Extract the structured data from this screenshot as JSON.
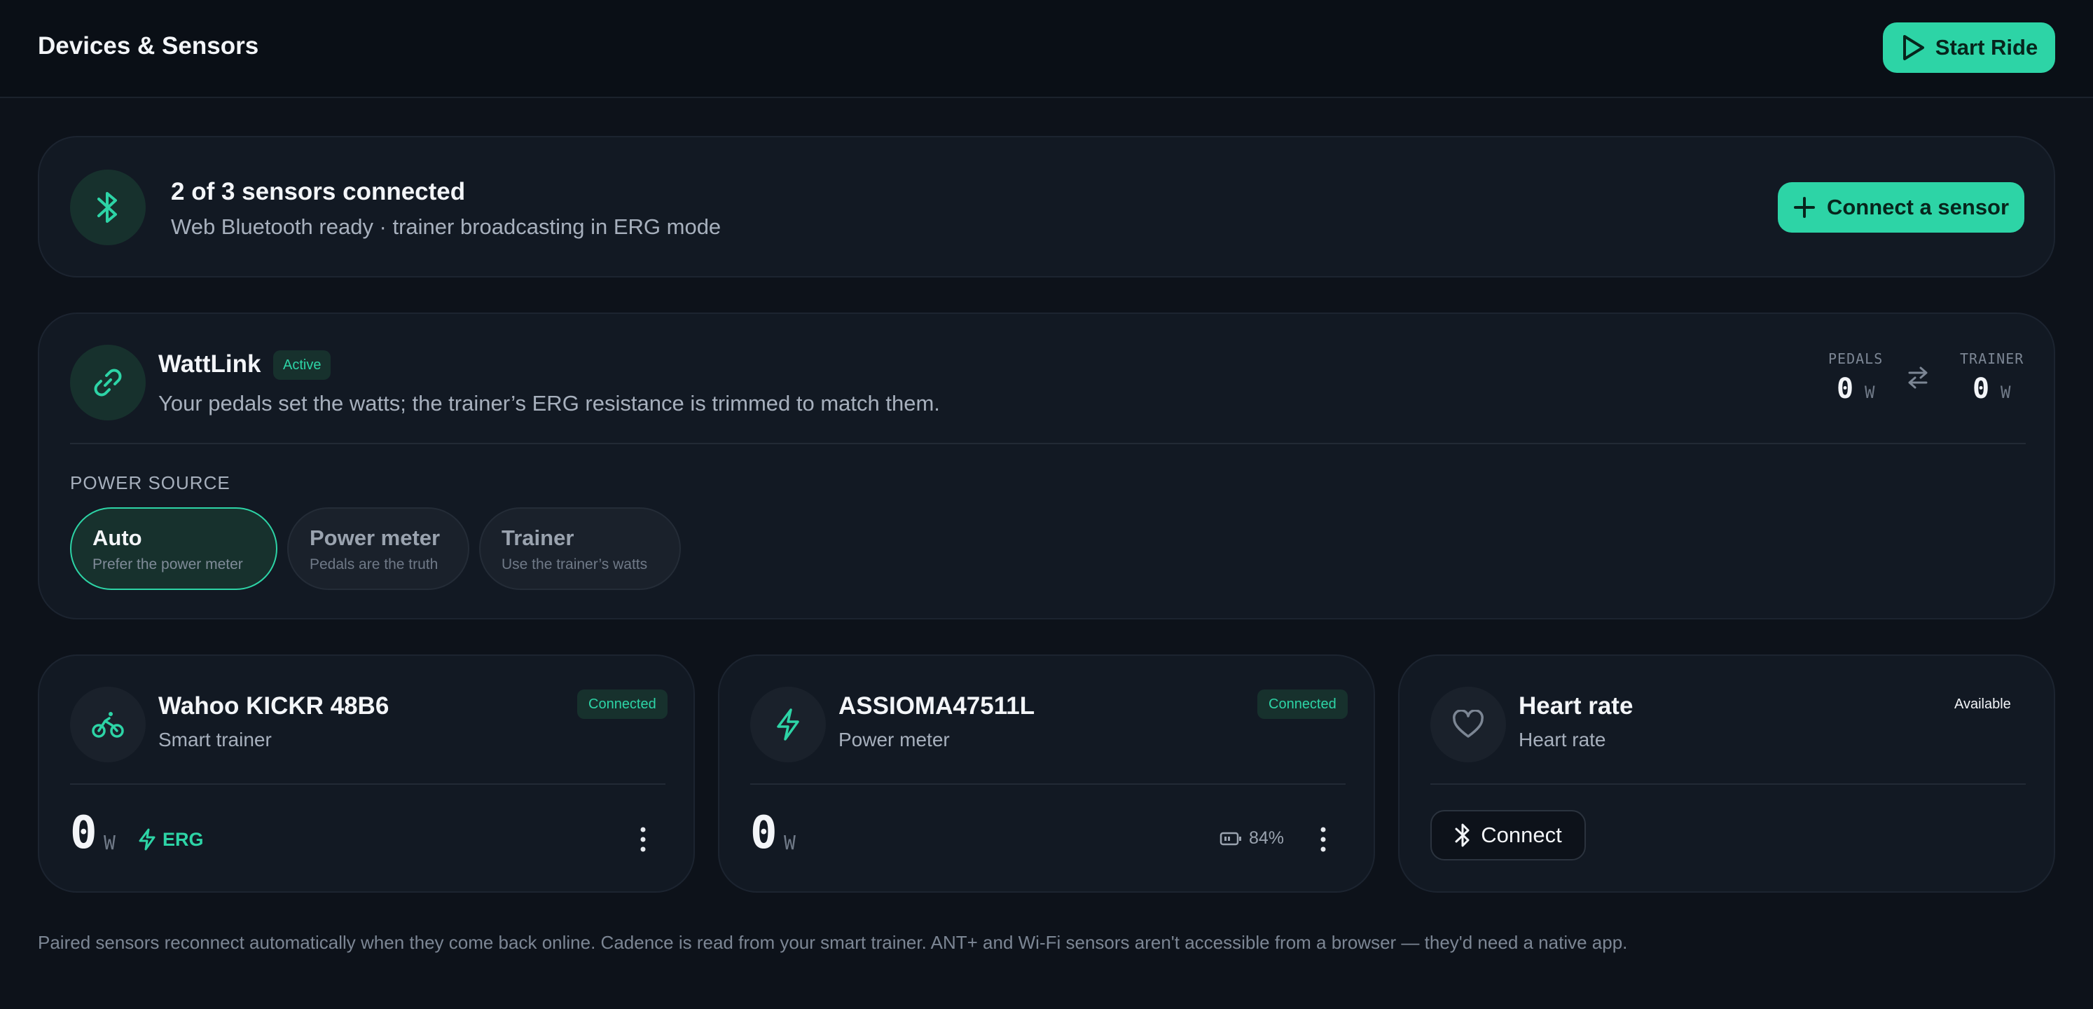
{
  "header": {
    "title": "Devices & Sensors",
    "start_label": "Start Ride"
  },
  "summary": {
    "title": "2 of 3 sensors connected",
    "subtitle": "Web Bluetooth ready · trainer broadcasting in ERG mode",
    "connect_label": "Connect a sensor"
  },
  "wattlink": {
    "title": "WattLink",
    "badge": "Active",
    "subtitle": "Your pedals set the watts; the trainer’s ERG resistance is trimmed to match them.",
    "pedals_label": "PEDALS",
    "pedals_value": "0",
    "trainer_label": "TRAINER",
    "trainer_value": "0",
    "unit": "W",
    "power_source_label": "POWER SOURCE",
    "options": [
      {
        "title": "Auto",
        "subtitle": "Prefer the power meter",
        "selected": true
      },
      {
        "title": "Power meter",
        "subtitle": "Pedals are the truth",
        "selected": false
      },
      {
        "title": "Trainer",
        "subtitle": "Use the trainer’s watts",
        "selected": false
      }
    ]
  },
  "devices": [
    {
      "name": "Wahoo KICKR 48B6",
      "type": "Smart trainer",
      "status": "Connected",
      "watts": "0",
      "unit": "W",
      "mode": "ERG",
      "icon": "bike-icon"
    },
    {
      "name": "ASSIOMA47511L",
      "type": "Power meter",
      "status": "Connected",
      "watts": "0",
      "unit": "W",
      "battery": "84%",
      "icon": "bolt-icon"
    },
    {
      "name": "Heart rate",
      "type": "Heart rate",
      "status": "Available",
      "connect_label": "Connect",
      "icon": "heart-icon"
    }
  ],
  "footnote": "Paired sensors reconnect automatically when they come back online. Cadence is read from your smart trainer. ANT+ and Wi-Fi sensors aren't accessible from a browser — they'd need a native app.",
  "colors": {
    "background": "#0d121a",
    "card": "#121923",
    "accent": "#2dd4a6",
    "muted_text": "#a7b0bd"
  }
}
